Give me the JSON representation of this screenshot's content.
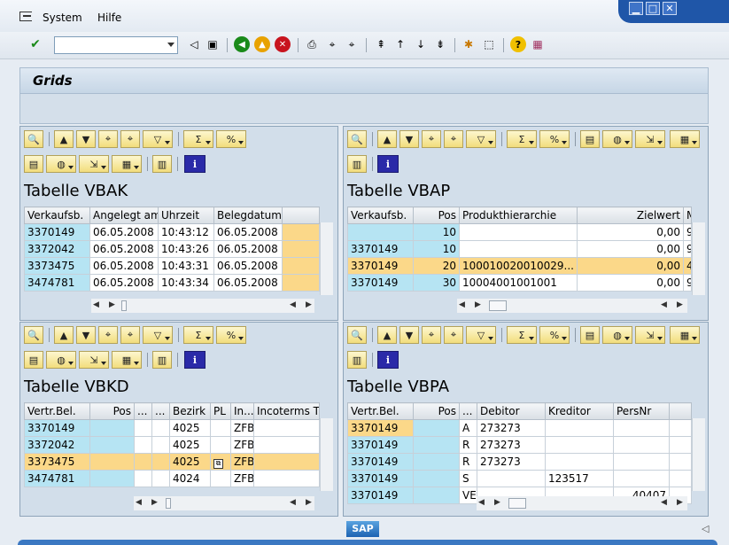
{
  "menu": {
    "system": "System",
    "hilfe": "Hilfe"
  },
  "window_controls": {
    "minimize": "▁",
    "maximize": "□",
    "close": "✕"
  },
  "toolbar": {
    "command_field": ""
  },
  "title": "Grids",
  "panels": {
    "vbak": {
      "title": "Tabelle VBAK",
      "columns": [
        "Verkaufsb.",
        "Angelegt am",
        "Uhrzeit",
        "Belegdatum",
        ""
      ],
      "rows": [
        [
          "3370149",
          "06.05.2008",
          "10:43:12",
          "06.05.2008",
          ""
        ],
        [
          "3372042",
          "06.05.2008",
          "10:43:26",
          "06.05.2008",
          ""
        ],
        [
          "3373475",
          "06.05.2008",
          "10:43:31",
          "06.05.2008",
          ""
        ],
        [
          "3474781",
          "06.05.2008",
          "10:43:34",
          "06.05.2008",
          ""
        ]
      ]
    },
    "vbap": {
      "title": "Tabelle VBAP",
      "columns": [
        "Verkaufsb.",
        "Pos",
        "Produkthierarchie",
        "Zielwert",
        "M"
      ],
      "rows": [
        [
          "",
          "10",
          "",
          "0,00",
          "9"
        ],
        [
          "3370149",
          "10",
          "",
          "0,00",
          "9"
        ],
        [
          "3370149",
          "20",
          "100010020010029...",
          "0,00",
          "4"
        ],
        [
          "3370149",
          "30",
          "10004001001001",
          "0,00",
          "9"
        ]
      ]
    },
    "vbkd": {
      "title": "Tabelle VBKD",
      "columns": [
        "Vertr.Bel.",
        "Pos",
        "...",
        "...",
        "Bezirk",
        "PL",
        "In...",
        "Incoterms T"
      ],
      "rows": [
        [
          "3370149",
          "",
          "",
          "",
          "4025",
          "",
          "ZFB",
          ""
        ],
        [
          "3372042",
          "",
          "",
          "",
          "4025",
          "",
          "ZFB",
          ""
        ],
        [
          "3373475",
          "",
          "",
          "",
          "4025",
          "",
          "ZFB",
          ""
        ],
        [
          "3474781",
          "",
          "",
          "",
          "4024",
          "",
          "ZFB",
          ""
        ]
      ]
    },
    "vbpa": {
      "title": "Tabelle VBPA",
      "columns": [
        "Vertr.Bel.",
        "Pos",
        "...",
        "Debitor",
        "Kreditor",
        "PersNr",
        ""
      ],
      "rows": [
        [
          "3370149",
          "",
          "A",
          "273273",
          "",
          "",
          ""
        ],
        [
          "3370149",
          "",
          "R",
          "273273",
          "",
          "",
          ""
        ],
        [
          "3370149",
          "",
          "R",
          "273273",
          "",
          "",
          ""
        ],
        [
          "3370149",
          "",
          "S",
          "",
          "123517",
          "",
          ""
        ],
        [
          "3370149",
          "",
          "VE",
          "",
          "",
          "40407",
          ""
        ]
      ]
    }
  },
  "colors": {
    "key_cell": "#b6e4f3",
    "selected_row": "#fbd889",
    "panel_bg": "#d2deea"
  },
  "footer": {
    "logo": "SAP"
  }
}
